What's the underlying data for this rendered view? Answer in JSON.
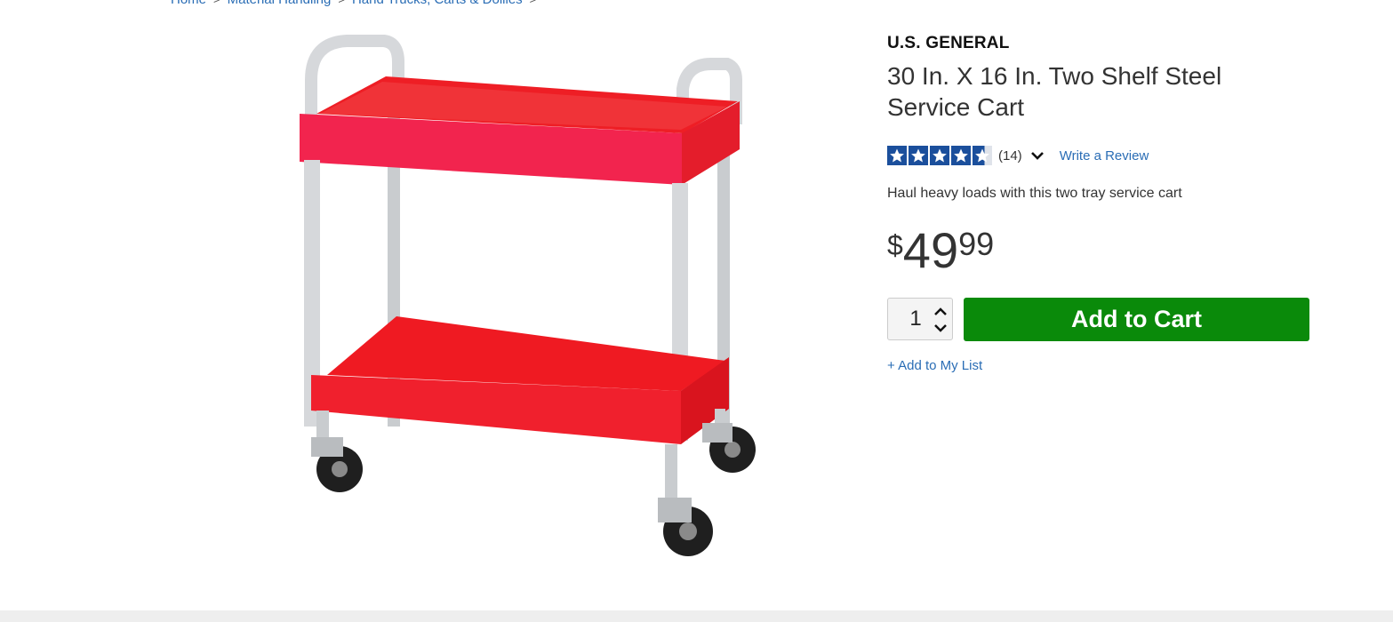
{
  "breadcrumb": {
    "items": [
      "Home",
      "Material Handling",
      "Hand Trucks, Carts & Dollies"
    ]
  },
  "product": {
    "brand": "U.S. GENERAL",
    "title": "30 In. X 16 In. Two Shelf Steel Service Cart",
    "rating": {
      "stars": 4.5,
      "count": "(14)",
      "write_review": "Write a Review"
    },
    "description": "Haul heavy loads with this two tray service cart",
    "price": {
      "currency": "$",
      "dollars": "49",
      "cents": "99"
    },
    "quantity": "1",
    "add_to_cart": "Add to Cart",
    "add_to_list": "+ Add to My List",
    "image_icon": "service-cart-image"
  },
  "colors": {
    "link": "#2a6db5",
    "add_to_cart_bg": "#0a8a0a",
    "star_bg": "#1b4f9c",
    "cart_red": "#e8141c"
  }
}
